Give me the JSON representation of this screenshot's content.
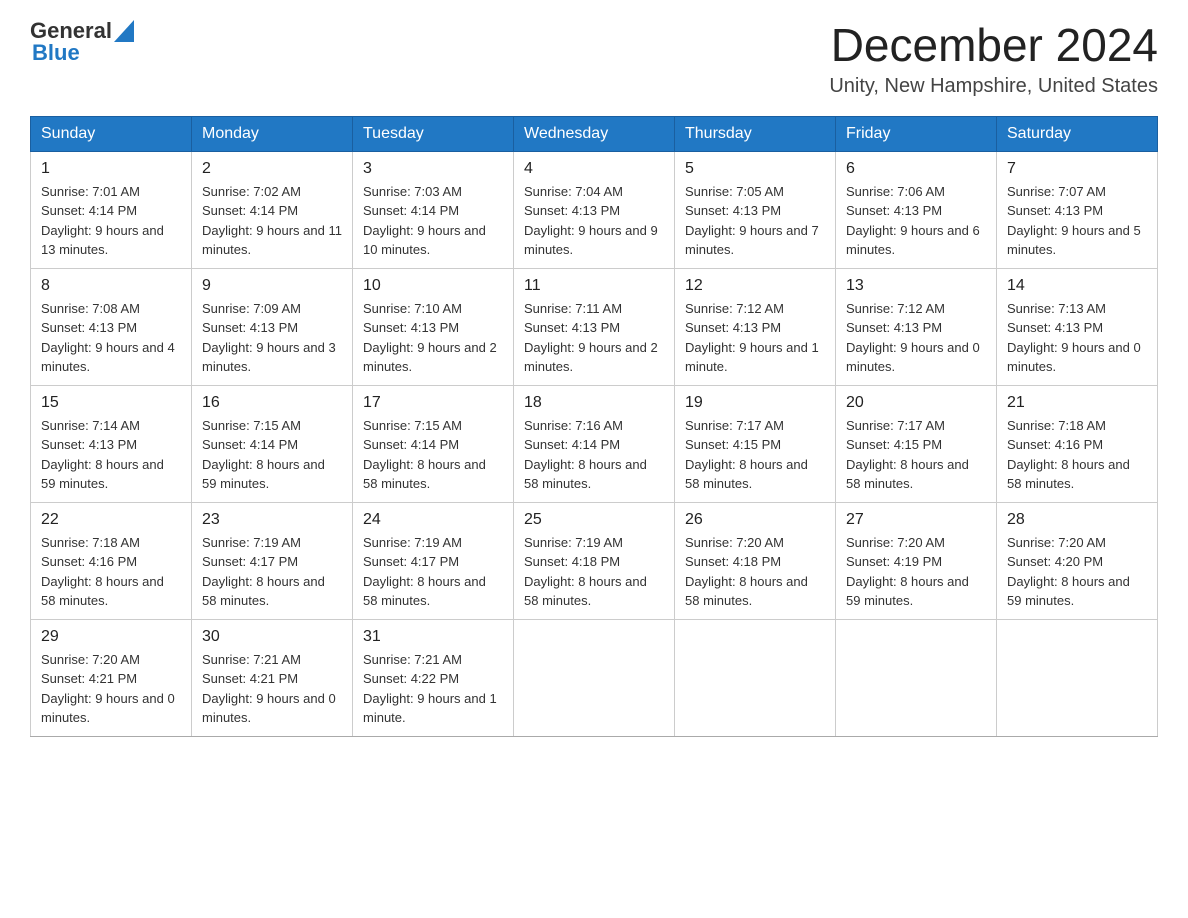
{
  "header": {
    "logo_general": "General",
    "logo_blue": "Blue",
    "title": "December 2024",
    "subtitle": "Unity, New Hampshire, United States"
  },
  "weekdays": [
    "Sunday",
    "Monday",
    "Tuesday",
    "Wednesday",
    "Thursday",
    "Friday",
    "Saturday"
  ],
  "weeks": [
    [
      {
        "day": "1",
        "sunrise": "7:01 AM",
        "sunset": "4:14 PM",
        "daylight": "9 hours and 13 minutes."
      },
      {
        "day": "2",
        "sunrise": "7:02 AM",
        "sunset": "4:14 PM",
        "daylight": "9 hours and 11 minutes."
      },
      {
        "day": "3",
        "sunrise": "7:03 AM",
        "sunset": "4:14 PM",
        "daylight": "9 hours and 10 minutes."
      },
      {
        "day": "4",
        "sunrise": "7:04 AM",
        "sunset": "4:13 PM",
        "daylight": "9 hours and 9 minutes."
      },
      {
        "day": "5",
        "sunrise": "7:05 AM",
        "sunset": "4:13 PM",
        "daylight": "9 hours and 7 minutes."
      },
      {
        "day": "6",
        "sunrise": "7:06 AM",
        "sunset": "4:13 PM",
        "daylight": "9 hours and 6 minutes."
      },
      {
        "day": "7",
        "sunrise": "7:07 AM",
        "sunset": "4:13 PM",
        "daylight": "9 hours and 5 minutes."
      }
    ],
    [
      {
        "day": "8",
        "sunrise": "7:08 AM",
        "sunset": "4:13 PM",
        "daylight": "9 hours and 4 minutes."
      },
      {
        "day": "9",
        "sunrise": "7:09 AM",
        "sunset": "4:13 PM",
        "daylight": "9 hours and 3 minutes."
      },
      {
        "day": "10",
        "sunrise": "7:10 AM",
        "sunset": "4:13 PM",
        "daylight": "9 hours and 2 minutes."
      },
      {
        "day": "11",
        "sunrise": "7:11 AM",
        "sunset": "4:13 PM",
        "daylight": "9 hours and 2 minutes."
      },
      {
        "day": "12",
        "sunrise": "7:12 AM",
        "sunset": "4:13 PM",
        "daylight": "9 hours and 1 minute."
      },
      {
        "day": "13",
        "sunrise": "7:12 AM",
        "sunset": "4:13 PM",
        "daylight": "9 hours and 0 minutes."
      },
      {
        "day": "14",
        "sunrise": "7:13 AM",
        "sunset": "4:13 PM",
        "daylight": "9 hours and 0 minutes."
      }
    ],
    [
      {
        "day": "15",
        "sunrise": "7:14 AM",
        "sunset": "4:13 PM",
        "daylight": "8 hours and 59 minutes."
      },
      {
        "day": "16",
        "sunrise": "7:15 AM",
        "sunset": "4:14 PM",
        "daylight": "8 hours and 59 minutes."
      },
      {
        "day": "17",
        "sunrise": "7:15 AM",
        "sunset": "4:14 PM",
        "daylight": "8 hours and 58 minutes."
      },
      {
        "day": "18",
        "sunrise": "7:16 AM",
        "sunset": "4:14 PM",
        "daylight": "8 hours and 58 minutes."
      },
      {
        "day": "19",
        "sunrise": "7:17 AM",
        "sunset": "4:15 PM",
        "daylight": "8 hours and 58 minutes."
      },
      {
        "day": "20",
        "sunrise": "7:17 AM",
        "sunset": "4:15 PM",
        "daylight": "8 hours and 58 minutes."
      },
      {
        "day": "21",
        "sunrise": "7:18 AM",
        "sunset": "4:16 PM",
        "daylight": "8 hours and 58 minutes."
      }
    ],
    [
      {
        "day": "22",
        "sunrise": "7:18 AM",
        "sunset": "4:16 PM",
        "daylight": "8 hours and 58 minutes."
      },
      {
        "day": "23",
        "sunrise": "7:19 AM",
        "sunset": "4:17 PM",
        "daylight": "8 hours and 58 minutes."
      },
      {
        "day": "24",
        "sunrise": "7:19 AM",
        "sunset": "4:17 PM",
        "daylight": "8 hours and 58 minutes."
      },
      {
        "day": "25",
        "sunrise": "7:19 AM",
        "sunset": "4:18 PM",
        "daylight": "8 hours and 58 minutes."
      },
      {
        "day": "26",
        "sunrise": "7:20 AM",
        "sunset": "4:18 PM",
        "daylight": "8 hours and 58 minutes."
      },
      {
        "day": "27",
        "sunrise": "7:20 AM",
        "sunset": "4:19 PM",
        "daylight": "8 hours and 59 minutes."
      },
      {
        "day": "28",
        "sunrise": "7:20 AM",
        "sunset": "4:20 PM",
        "daylight": "8 hours and 59 minutes."
      }
    ],
    [
      {
        "day": "29",
        "sunrise": "7:20 AM",
        "sunset": "4:21 PM",
        "daylight": "9 hours and 0 minutes."
      },
      {
        "day": "30",
        "sunrise": "7:21 AM",
        "sunset": "4:21 PM",
        "daylight": "9 hours and 0 minutes."
      },
      {
        "day": "31",
        "sunrise": "7:21 AM",
        "sunset": "4:22 PM",
        "daylight": "9 hours and 1 minute."
      },
      null,
      null,
      null,
      null
    ]
  ],
  "labels": {
    "sunrise": "Sunrise:",
    "sunset": "Sunset:",
    "daylight": "Daylight:"
  }
}
